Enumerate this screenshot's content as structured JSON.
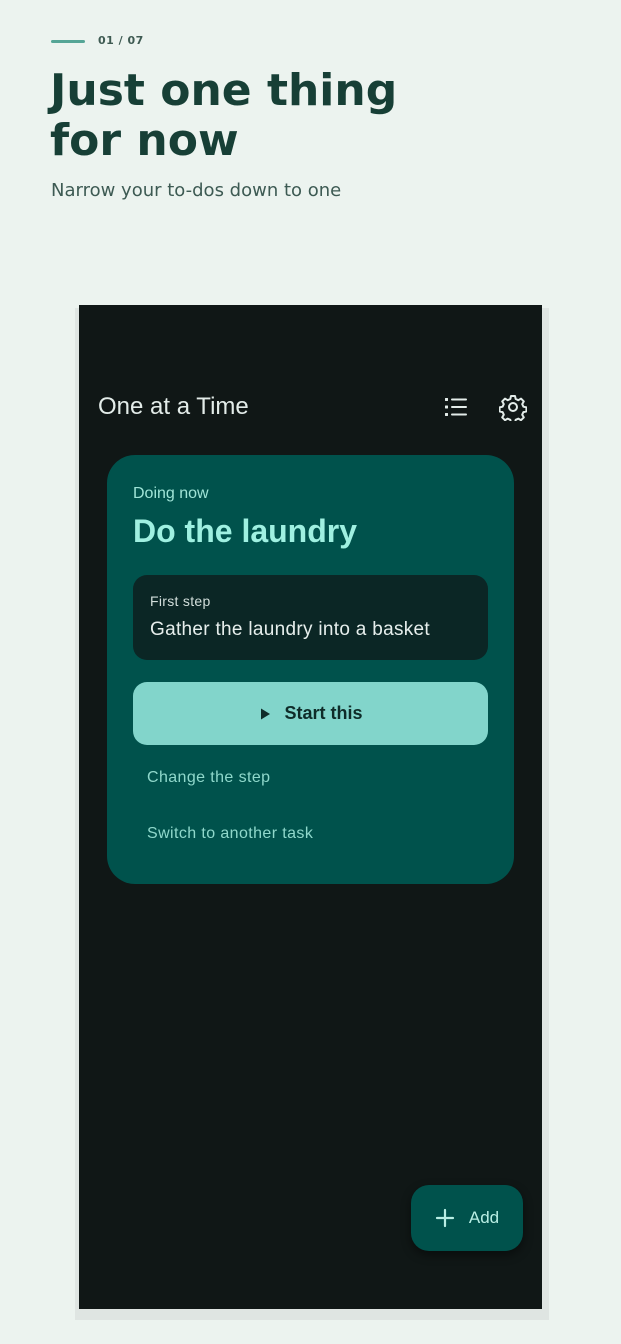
{
  "promo": {
    "counter": "01 / 07",
    "title": "Just one thing for now",
    "subtitle": "Narrow your to-dos down to one"
  },
  "app": {
    "title": "One at a Time",
    "toolbar": {
      "list_icon": "list-icon",
      "settings_icon": "gear-icon"
    }
  },
  "current_task": {
    "label": "Doing now",
    "title": "Do the laundry",
    "step_label": "First step",
    "step_text": "Gather the laundry into a basket",
    "start_label": "Start this",
    "start_icon": "play-icon",
    "change_step_label": "Change the step",
    "switch_task_label": "Switch to another task"
  },
  "fab": {
    "icon": "plus-icon",
    "label": "Add"
  },
  "colors": {
    "page_bg": "#ecf3ef",
    "screen_bg": "#101716",
    "card_bg": "#00524c",
    "accent": "#82d5cb",
    "accent_text": "#9ff0e1"
  }
}
